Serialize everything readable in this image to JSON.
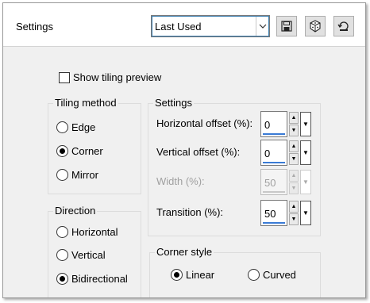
{
  "header": {
    "title": "Settings",
    "preset_value": "Last Used",
    "buttons": [
      "save-icon",
      "dice-icon",
      "reset-icon"
    ]
  },
  "show_tiling_preview": {
    "label": "Show tiling preview",
    "checked": false
  },
  "tiling_method": {
    "title": "Tiling method",
    "options": [
      {
        "label": "Edge",
        "selected": false
      },
      {
        "label": "Corner",
        "selected": true
      },
      {
        "label": "Mirror",
        "selected": false
      }
    ]
  },
  "direction": {
    "title": "Direction",
    "options": [
      {
        "label": "Horizontal",
        "selected": false
      },
      {
        "label": "Vertical",
        "selected": false
      },
      {
        "label": "Bidirectional",
        "selected": true
      }
    ]
  },
  "settings": {
    "title": "Settings",
    "fields": [
      {
        "label": "Horizontal offset (%):",
        "value": "0",
        "enabled": true
      },
      {
        "label": "Vertical offset (%):",
        "value": "0",
        "enabled": true
      },
      {
        "label": "Width (%):",
        "value": "50",
        "enabled": false
      },
      {
        "label": "Transition (%):",
        "value": "50",
        "enabled": true
      }
    ]
  },
  "corner_style": {
    "title": "Corner style",
    "options": [
      {
        "label": "Linear",
        "selected": true
      },
      {
        "label": "Curved",
        "selected": false
      }
    ]
  },
  "colors": {
    "focus_bar": "#3a7bd5",
    "panel_bg": "#f0f0f0"
  }
}
